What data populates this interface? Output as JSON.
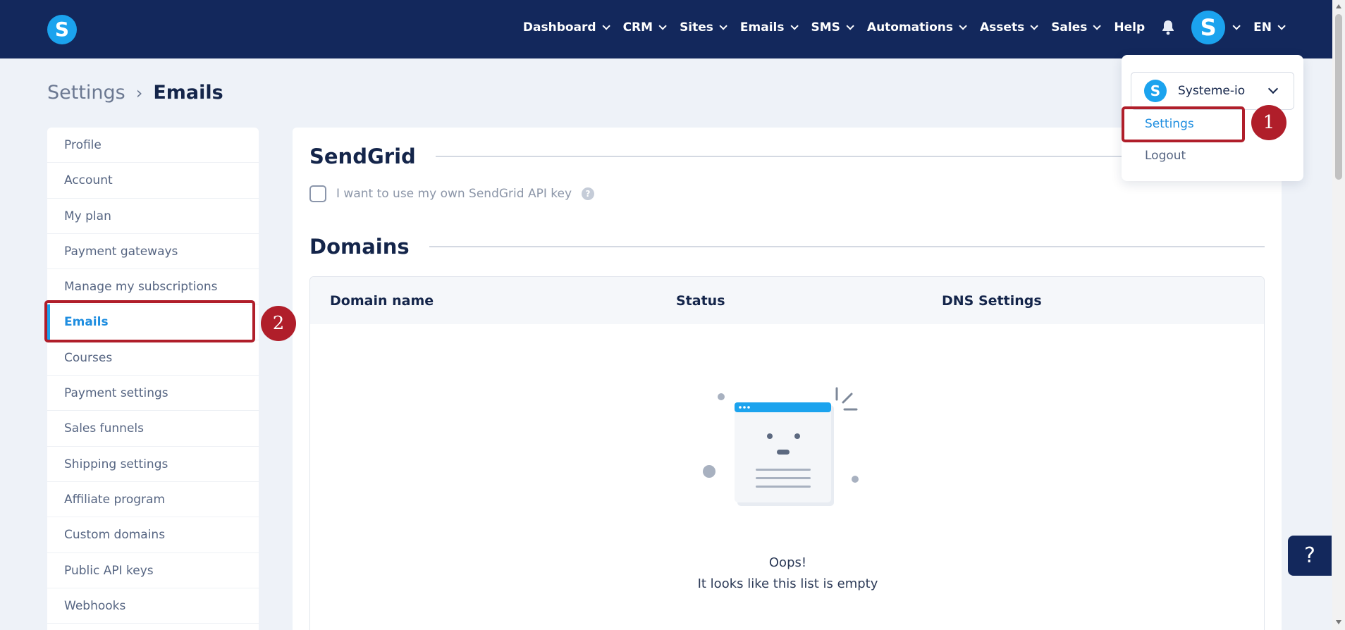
{
  "navbar": {
    "logo_letter": "S",
    "items": [
      {
        "label": "Dashboard"
      },
      {
        "label": "CRM"
      },
      {
        "label": "Sites"
      },
      {
        "label": "Emails"
      },
      {
        "label": "SMS"
      },
      {
        "label": "Automations"
      },
      {
        "label": "Assets"
      },
      {
        "label": "Sales"
      }
    ],
    "help_label": "Help",
    "avatar_letter": "S",
    "language": "EN",
    "icons": {
      "bell": "bell-icon",
      "chevron": "chevron-down-icon"
    }
  },
  "breadcrumb": {
    "parent": "Settings",
    "separator": "›",
    "current": "Emails"
  },
  "sidebar": {
    "items": [
      {
        "label": "Profile"
      },
      {
        "label": "Account"
      },
      {
        "label": "My plan"
      },
      {
        "label": "Payment gateways"
      },
      {
        "label": "Manage my subscriptions"
      },
      {
        "label": "Emails",
        "active": true
      },
      {
        "label": "Courses"
      },
      {
        "label": "Payment settings"
      },
      {
        "label": "Sales funnels"
      },
      {
        "label": "Shipping settings"
      },
      {
        "label": "Affiliate program"
      },
      {
        "label": "Custom domains"
      },
      {
        "label": "Public API keys"
      },
      {
        "label": "Webhooks"
      }
    ]
  },
  "main": {
    "sendgrid": {
      "title": "SendGrid",
      "checkbox_label": "I want to use my own SendGrid API key",
      "checked": false,
      "help_glyph": "?"
    },
    "domains": {
      "title": "Domains",
      "columns": [
        "Domain name",
        "Status",
        "DNS Settings"
      ],
      "rows": [],
      "empty_title": "Oops!",
      "empty_message": "It looks like this list is empty"
    }
  },
  "dropdown": {
    "account_logo_letter": "S",
    "account_name": "Systeme-io",
    "settings_label": "Settings",
    "logout_label": "Logout"
  },
  "annotations": {
    "badge_1": "1",
    "badge_2": "2",
    "color": "#b01e2a"
  },
  "help_fab": "?",
  "colors": {
    "navbar": "#13285c",
    "brand_blue": "#1ba3ee",
    "active_link": "#1f8ee0",
    "page_bg": "#eef2f8"
  }
}
